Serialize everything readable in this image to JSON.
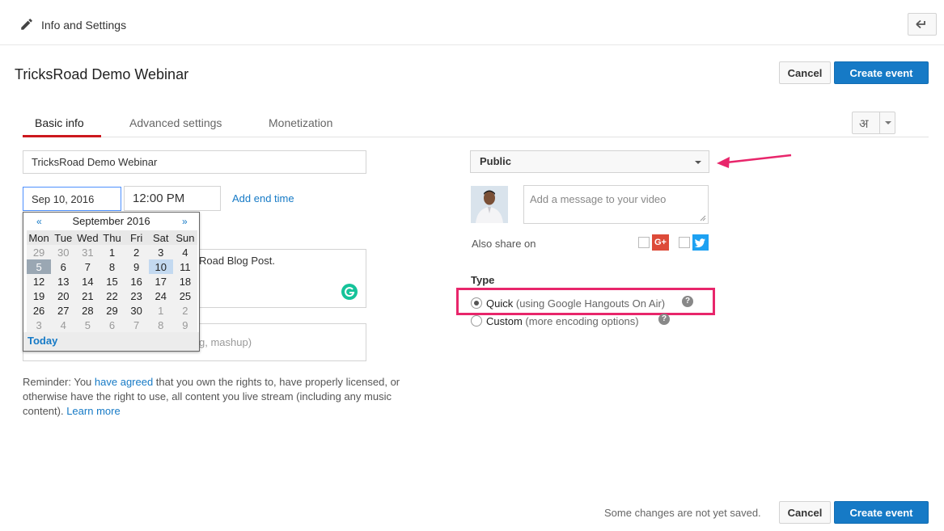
{
  "topbar": {
    "title": "Info and Settings"
  },
  "event": {
    "title": "TricksRoad Demo Webinar"
  },
  "actions": {
    "cancel_label": "Cancel",
    "create_label": "Create event"
  },
  "tabs": [
    {
      "label": "Basic info"
    },
    {
      "label": "Advanced settings"
    },
    {
      "label": "Monetization"
    }
  ],
  "language": {
    "glyph": "अ"
  },
  "form": {
    "title_value": "TricksRoad Demo Webinar",
    "date_value": "Sep 10, 2016",
    "time_value": "12:00 PM",
    "add_end_time": "Add end time",
    "description_visible": "Road Blog Post.",
    "tags_visible": "g, mashup)"
  },
  "calendar": {
    "prev": "«",
    "next": "»",
    "month": "September 2016",
    "weekdays": [
      "Mon",
      "Tue",
      "Wed",
      "Thu",
      "Fri",
      "Sat",
      "Sun"
    ],
    "weeks": [
      [
        "29",
        "30",
        "31",
        "1",
        "2",
        "3",
        "4"
      ],
      [
        "5",
        "6",
        "7",
        "8",
        "9",
        "10",
        "11"
      ],
      [
        "12",
        "13",
        "14",
        "15",
        "16",
        "17",
        "18"
      ],
      [
        "19",
        "20",
        "21",
        "22",
        "23",
        "24",
        "25"
      ],
      [
        "26",
        "27",
        "28",
        "29",
        "30",
        "1",
        "2"
      ],
      [
        "3",
        "4",
        "5",
        "6",
        "7",
        "8",
        "9"
      ]
    ],
    "today_label": "Today"
  },
  "reminder": {
    "prefix": "Reminder: You ",
    "agreed_link": "have agreed",
    "middle": " that you own the rights to, have properly licensed, or otherwise have the right to use, all content you live stream (including any music content). ",
    "learn_more": "Learn more"
  },
  "privacy": {
    "value": "Public"
  },
  "message": {
    "placeholder": "Add a message to your video"
  },
  "share": {
    "label": "Also share on",
    "gplus_label": "G+"
  },
  "type": {
    "label": "Type",
    "quick_label": "Quick",
    "quick_sub": "(using Google Hangouts On Air)",
    "custom_label": "Custom",
    "custom_sub": "(more encoding options)",
    "help_glyph": "?"
  },
  "footer": {
    "note": "Some changes are not yet saved."
  },
  "colors": {
    "accent": "#167ac6",
    "tab_underline": "#cc181e",
    "highlight": "#e8266b"
  }
}
